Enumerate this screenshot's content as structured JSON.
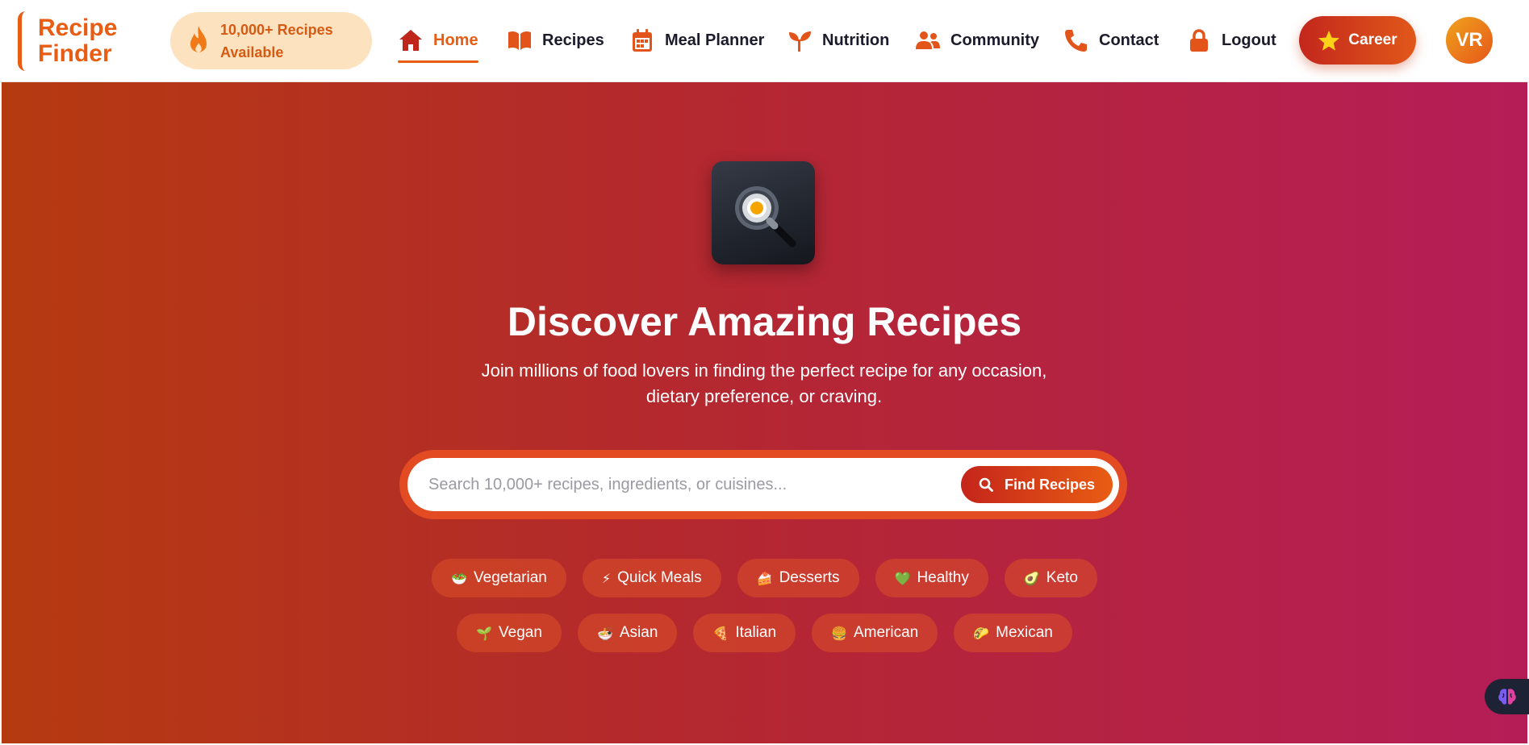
{
  "logo": {
    "line1": "Recipe",
    "line2": "Finder"
  },
  "badge": {
    "line1": "10,000+ Recipes",
    "line2": "Available",
    "icon": "flame-icon"
  },
  "nav": {
    "items": [
      {
        "label": "Home",
        "icon": "home-icon",
        "active": true
      },
      {
        "label": "Recipes",
        "icon": "book-icon"
      },
      {
        "label": "Meal Planner",
        "icon": "calendar-icon"
      },
      {
        "label": "Nutrition",
        "icon": "seedling-icon"
      },
      {
        "label": "Community",
        "icon": "users-icon"
      },
      {
        "label": "Contact",
        "icon": "phone-icon"
      },
      {
        "label": "Logout",
        "icon": "lock-icon"
      }
    ]
  },
  "career": {
    "label": "Career",
    "icon": "star-icon"
  },
  "avatar": {
    "initials": "VR"
  },
  "hero": {
    "icon": "frying-pan-search-icon",
    "title": "Discover Amazing Recipes",
    "subtitle_line1": "Join millions of food lovers in finding the perfect recipe for any occasion,",
    "subtitle_line2": "dietary preference, or craving."
  },
  "search": {
    "placeholder": "Search 10,000+ recipes, ingredients, or cuisines...",
    "value": "",
    "button_label": "Find Recipes",
    "button_icon": "search-icon"
  },
  "tags": {
    "row1": [
      {
        "emoji": "🥗",
        "label": "Vegetarian"
      },
      {
        "emoji": "⚡",
        "label": "Quick Meals"
      },
      {
        "emoji": "🍰",
        "label": "Desserts"
      },
      {
        "emoji": "💚",
        "label": "Healthy"
      },
      {
        "emoji": "🥑",
        "label": "Keto"
      }
    ],
    "row2": [
      {
        "emoji": "🌱",
        "label": "Vegan"
      },
      {
        "emoji": "🍜",
        "label": "Asian"
      },
      {
        "emoji": "🍕",
        "label": "Italian"
      },
      {
        "emoji": "🍔",
        "label": "American"
      },
      {
        "emoji": "🌮",
        "label": "Mexican"
      }
    ]
  },
  "floating_button": {
    "icon": "brain-icon"
  },
  "colors": {
    "accent": "#e85d13",
    "hero_gradient_start": "#b53a10",
    "hero_gradient_end": "#b51d57",
    "badge_bg": "#fde2c0"
  }
}
